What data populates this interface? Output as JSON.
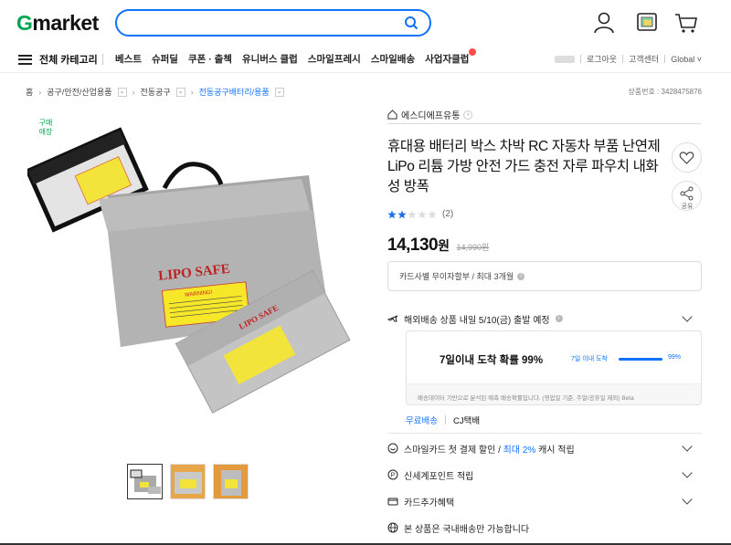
{
  "header": {
    "logo_g": "G",
    "logo_rest": "market",
    "search": {
      "placeholder": ""
    },
    "icons": [
      "user-icon",
      "coupon-icon",
      "cart-icon"
    ]
  },
  "nav": {
    "all_categories": "전체 카테고리",
    "links": [
      "베스트",
      "슈퍼딜",
      "쿠폰 · 출첵",
      "유니버스 클럽",
      "스마일프레시",
      "스마일배송",
      "사업자클럽"
    ],
    "util": [
      "로그아웃",
      "고객센터",
      "Global"
    ]
  },
  "breadcrumb": {
    "home": "홈",
    "items": [
      "공구/안전/산업용품",
      "전동공구",
      "전동공구배터리/용품"
    ],
    "product_no": "상품번호 : 3428475876"
  },
  "gallery": {
    "buy_label_1": "구매",
    "buy_label_2": "애장",
    "image_text": "LIPO SAFE",
    "warning_text": "WARNING!"
  },
  "product": {
    "seller": "에스디에프유통",
    "title": "휴대용 배터리 박스 차박 RC 자동차 부품 난연제 LiPo 리튬 가방 안전 가드 충전 자루 파우치 내화성 방폭",
    "share_label": "공유",
    "rating_stars": 2,
    "rating_max": 5,
    "review_count": "(2)",
    "price": "14,130",
    "price_unit": "원",
    "original_price": "14,990원",
    "card_installment": "카드사별 무이자할부 / 최대 3개월"
  },
  "shipping": {
    "overseas": "해외배송 상품 내일 5/10(금) 출발 예정",
    "probability": "7일이내 도착 확률 99%",
    "bar_label": "7일 이내 도착",
    "bar_pct": "99%",
    "bar_value": 0.99,
    "note": "배송데이터 기반으로 분석된 예측 배송확률입니다. (영업일 기준, 주말/공휴일 제외) Beta",
    "free": "무료배송",
    "courier": "CJ택배"
  },
  "benefits": {
    "smile_card_prefix": "스마일카드 첫 결제 할인 / ",
    "smile_card_highlight": "최대 2%",
    "smile_card_suffix": " 캐시 적립",
    "shinsegae": "신세계포인트 적립",
    "card_extra": "카드추가혜택",
    "domestic_only": "본 상품은 국내배송만 가능합니다"
  },
  "colors": {
    "brand_green": "#00a550",
    "accent_blue": "#0f73ff",
    "badge_red": "#ff4d4d"
  }
}
